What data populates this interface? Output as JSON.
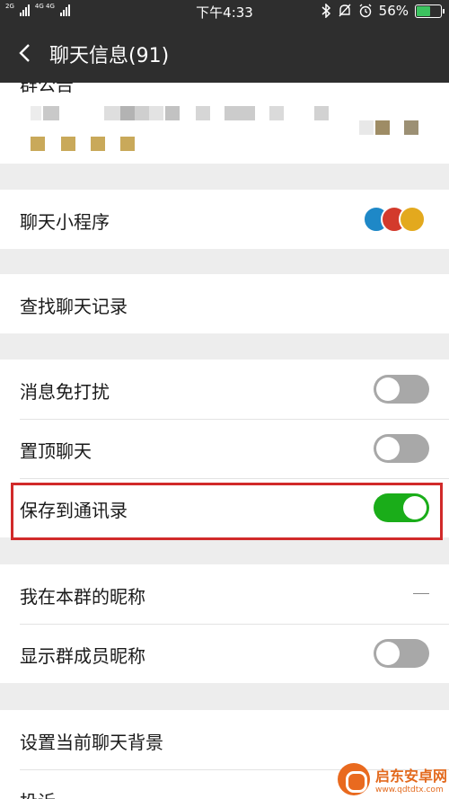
{
  "status_bar": {
    "network_labels": [
      "2G",
      "4G 4G"
    ],
    "time": "下午4:33",
    "battery_percent": "56%",
    "battery_level": 0.56,
    "icons": [
      "bluetooth-icon",
      "mute-icon",
      "alarm-icon",
      "battery-icon"
    ]
  },
  "nav": {
    "title": "聊天信息(91)",
    "back_icon": "chevron-left-icon"
  },
  "notice": {
    "label": "群公告"
  },
  "mini_programs": {
    "label": "聊天小程序"
  },
  "search_history": {
    "label": "查找聊天记录"
  },
  "settings": {
    "mute": {
      "label": "消息免打扰",
      "on": false
    },
    "pin": {
      "label": "置顶聊天",
      "on": false
    },
    "save_contacts": {
      "label": "保存到通讯录",
      "on": true
    }
  },
  "nickname": {
    "my_nickname_label": "我在本群的昵称",
    "show_member_nickname": {
      "label": "显示群成员昵称",
      "on": false
    }
  },
  "more": {
    "background_label": "设置当前聊天背景",
    "complaint_label": "投诉"
  },
  "watermark": {
    "name": "启东安卓网",
    "url": "www.qdtdtx.com"
  },
  "colors": {
    "header_bg": "#2e2e2e",
    "switch_on": "#1aad19",
    "switch_off": "#a8a8a8",
    "highlight_border": "#d12a2a"
  }
}
